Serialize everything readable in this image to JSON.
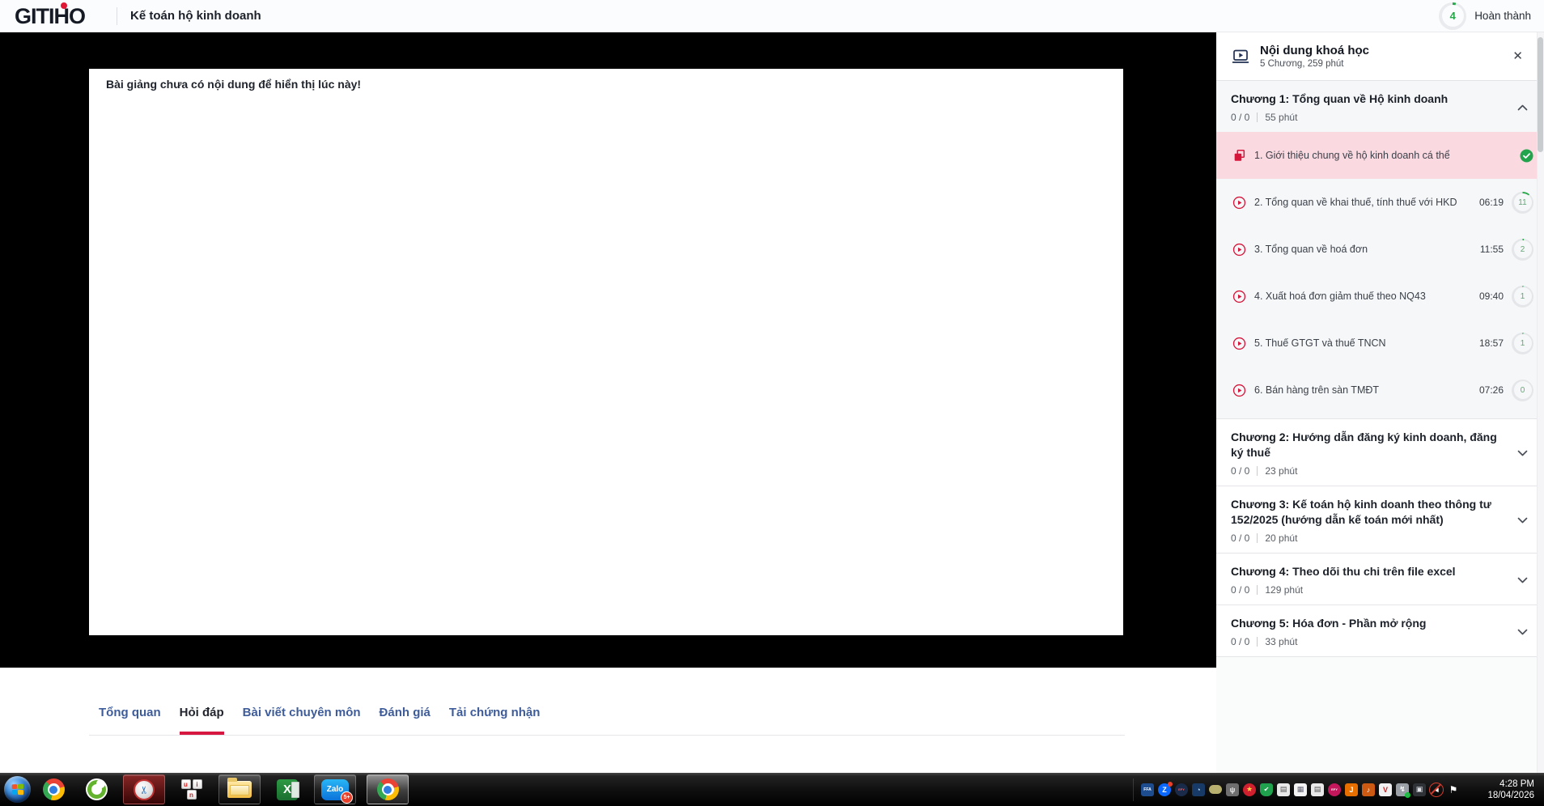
{
  "header": {
    "logo": "GITIHO",
    "course_title": "Kế toán hộ kinh doanh",
    "progress_value": "4",
    "progress_percent": 4,
    "complete_label": "Hoàn thành"
  },
  "player": {
    "empty_message": "Bài giảng chưa có nội dung để hiển thị lúc này!"
  },
  "tabs": [
    {
      "label": "Tổng quan",
      "active": false
    },
    {
      "label": "Hỏi đáp",
      "active": true
    },
    {
      "label": "Bài viết chuyên môn",
      "active": false
    },
    {
      "label": "Đánh giá",
      "active": false
    },
    {
      "label": "Tải chứng nhận",
      "active": false
    }
  ],
  "sidebar": {
    "title": "Nội dung khoá học",
    "subtitle": "5 Chương, 259 phút",
    "close_glyph": "✕",
    "chapters": [
      {
        "prefix": "Chương 1:",
        "title": "Tổng quan về Hộ kinh doanh",
        "progress": "0 / 0",
        "duration": "55 phút",
        "expanded": true,
        "lessons": [
          {
            "title": "1. Giới thiệu chung về hộ kinh doanh cá thể",
            "type": "doc",
            "selected": true,
            "completed": true
          },
          {
            "title": "2. Tổng quan về khai thuế, tính thuế với HKD",
            "type": "video",
            "time": "06:19",
            "badge": "11",
            "badge_percent": 11
          },
          {
            "title": "3. Tổng quan về hoá đơn",
            "type": "video",
            "time": "11:55",
            "badge": "2",
            "badge_percent": 2
          },
          {
            "title": "4. Xuất hoá đơn giảm thuế theo NQ43",
            "type": "video",
            "time": "09:40",
            "badge": "1",
            "badge_percent": 1
          },
          {
            "title": "5. Thuế GTGT và thuế TNCN",
            "type": "video",
            "time": "18:57",
            "badge": "1",
            "badge_percent": 1
          },
          {
            "title": "6. Bán hàng trên sàn TMĐT",
            "type": "video",
            "time": "07:26",
            "badge": "0",
            "badge_percent": 0
          }
        ]
      },
      {
        "prefix": "Chương 2:",
        "title": "Hướng dẫn đăng ký kinh doanh, đăng ký thuế",
        "progress": "0 / 0",
        "duration": "23 phút",
        "expanded": false,
        "lessons": []
      },
      {
        "prefix": "Chương 3:",
        "title": "Kế toán hộ kinh doanh theo thông tư 152/2025 (hướng dẫn kế toán mới nhất)",
        "progress": "0 / 0",
        "duration": "20 phút",
        "expanded": false,
        "lessons": []
      },
      {
        "prefix": "Chương 4:",
        "title": "Theo dõi thu chi trên file excel",
        "progress": "0 / 0",
        "duration": "129 phút",
        "expanded": false,
        "lessons": []
      },
      {
        "prefix": "Chương 5:",
        "title": "Hóa đơn - Phần mở rộng",
        "progress": "0 / 0",
        "duration": "33 phút",
        "expanded": false,
        "lessons": []
      }
    ]
  },
  "taskbar": {
    "clock_time": "4:28 PM",
    "clock_date": "18/04/2026",
    "apps": [
      {
        "id": "chrome",
        "icon": "chrome",
        "tile": false
      },
      {
        "id": "coccoc",
        "icon": "coccoc",
        "tile": false
      },
      {
        "id": "snipping-tool",
        "icon": "snip",
        "tile": true,
        "glyph": "✂"
      },
      {
        "id": "unikey",
        "icon": "unikey",
        "tile": false,
        "keys": [
          "u",
          "i",
          "n"
        ]
      },
      {
        "id": "explorer",
        "icon": "folder",
        "tile": true
      },
      {
        "id": "excel",
        "icon": "excel",
        "tile": false,
        "glyph": "X"
      },
      {
        "id": "zalo",
        "icon": "zalo",
        "tile": true,
        "glyph": "Zalo",
        "badge": "5+"
      },
      {
        "id": "chrome-active",
        "icon": "chrome",
        "tile": true,
        "active": true
      }
    ],
    "tray": [
      {
        "name": "ffa-icon",
        "glyph": "FFA",
        "bg": "#1d4c8f",
        "fg": "#ffffff",
        "shape": "square",
        "fs": 5
      },
      {
        "name": "zalo-tray-icon",
        "glyph": "Z",
        "bg": "#0a68ff",
        "fg": "#ffffff",
        "shape": "circle",
        "overlay": "red-dot"
      },
      {
        "name": "efy-icon",
        "glyph": "EFY",
        "bg": "#1a2b4a",
        "fg": "#ff6060",
        "shape": "circle",
        "fs": 4
      },
      {
        "name": "gauge-icon",
        "glyph": "◔",
        "bg": "#173a66",
        "fg": "#bfe1ff",
        "shape": "square"
      },
      {
        "name": "etoken-icon",
        "glyph": "",
        "bg": "#b7b06e",
        "fg": "#ffffff",
        "shape": "pill"
      },
      {
        "name": "signal-icon",
        "glyph": "ψ",
        "bg": "#6f6f6f",
        "fg": "#e8e8e8",
        "shape": "square"
      },
      {
        "name": "tax-emblem-icon",
        "glyph": "★",
        "bg": "#d01f2e",
        "fg": "#ffd24a",
        "shape": "circle"
      },
      {
        "name": "shield-check-icon",
        "glyph": "✔",
        "bg": "#1fa14e",
        "fg": "#ffffff",
        "shape": "shield",
        "fs": 8
      },
      {
        "name": "printer-icon",
        "glyph": "▤",
        "bg": "#e9e9e9",
        "fg": "#555555",
        "shape": "square"
      },
      {
        "name": "form-icon",
        "glyph": "▦",
        "bg": "#f4f4f4",
        "fg": "#666677",
        "shape": "square"
      },
      {
        "name": "printer-icon-2",
        "glyph": "▤",
        "bg": "#e9e9e9",
        "fg": "#555555",
        "shape": "square"
      },
      {
        "name": "efy-pink-icon",
        "glyph": "EFY",
        "bg": "#c2185b",
        "fg": "#ffffff",
        "shape": "circle",
        "fs": 4
      },
      {
        "name": "java-icon",
        "glyph": "J",
        "bg": "#e76f00",
        "fg": "#ffffff",
        "shape": "square"
      },
      {
        "name": "volume-orange-icon",
        "glyph": "♪",
        "bg": "#cc5a12",
        "fg": "#ffffff",
        "shape": "square"
      },
      {
        "name": "vmware-icon",
        "glyph": "V",
        "bg": "#f2f2f2",
        "fg": "#cc2222",
        "shape": "square"
      },
      {
        "name": "usb-icon",
        "glyph": "↯",
        "bg": "#9aa0a6",
        "fg": "#ffffff",
        "shape": "square",
        "overlay": "green-dot"
      },
      {
        "name": "network-icon",
        "glyph": "▣",
        "bg": "#2f3236",
        "fg": "#dfe3e8",
        "shape": "square"
      },
      {
        "name": "volume-muted-icon",
        "glyph": "◄",
        "bg": "transparent",
        "fg": "#ffffff",
        "shape": "circle",
        "overlay": "slash"
      },
      {
        "name": "language-flag-icon",
        "glyph": "⚑",
        "bg": "transparent",
        "fg": "#ffffff",
        "shape": "square",
        "fs": 12
      }
    ]
  },
  "colors": {
    "accent_red": "#d6173f",
    "success_green": "#21a44b",
    "tab_blue": "#3e5c99",
    "selected_lesson_pink": "#fbd9e1",
    "taskbar_black": "#0e0e0e"
  }
}
